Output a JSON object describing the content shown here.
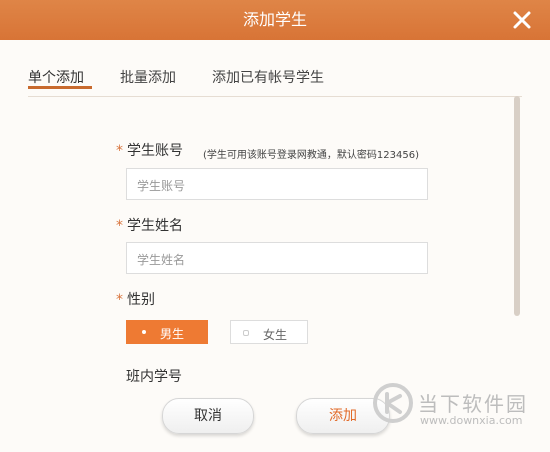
{
  "dialog": {
    "title": "添加学生",
    "close_icon": "close-icon",
    "accent": "#df8547"
  },
  "tabs": [
    {
      "label": "单个添加",
      "active": true
    },
    {
      "label": "批量添加",
      "active": false
    },
    {
      "label": "添加已有帐号学生",
      "active": false
    }
  ],
  "form": {
    "account": {
      "required_mark": "*",
      "label": "学生账号",
      "hint": "(学生可用该账号登录网教通，默认密码123456)",
      "placeholder": "学生账号"
    },
    "name": {
      "required_mark": "*",
      "label": "学生姓名",
      "placeholder": "学生姓名"
    },
    "gender": {
      "required_mark": "*",
      "label": "性别",
      "options": [
        "男生",
        "女生"
      ],
      "selected": "男生"
    },
    "class_number": {
      "label": "班内学号"
    }
  },
  "buttons": {
    "cancel": "取消",
    "add": "添加"
  },
  "watermark": {
    "text": "当下软件园",
    "url": "www.downxia.com"
  }
}
